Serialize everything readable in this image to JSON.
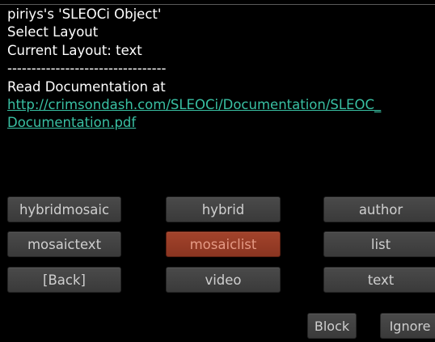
{
  "message": {
    "line1": "piriys's 'SLEOCi Object'",
    "line2": "Select Layout",
    "line3": "Current Layout: text",
    "separator": "---------------------------------",
    "line4": "Read Documentation at",
    "link_part1": "http://crimsondash.com/SLEOCi/Documentation/SLEOC_",
    "link_part2": "Documentation.pdf"
  },
  "buttons": {
    "hybridmosaic": "hybridmosaic",
    "hybrid": "hybrid",
    "author": "author",
    "mosaictext": "mosaictext",
    "mosaiclist": "mosaiclist",
    "list": "list",
    "back": "[Back]",
    "video": "video",
    "text": "text"
  },
  "footer": {
    "block": "Block",
    "ignore": "Ignore"
  },
  "colors": {
    "background": "#000000",
    "text": "#ffffff",
    "link": "#39c0a3",
    "button": "#444444",
    "selected_button": "#a3432b"
  }
}
